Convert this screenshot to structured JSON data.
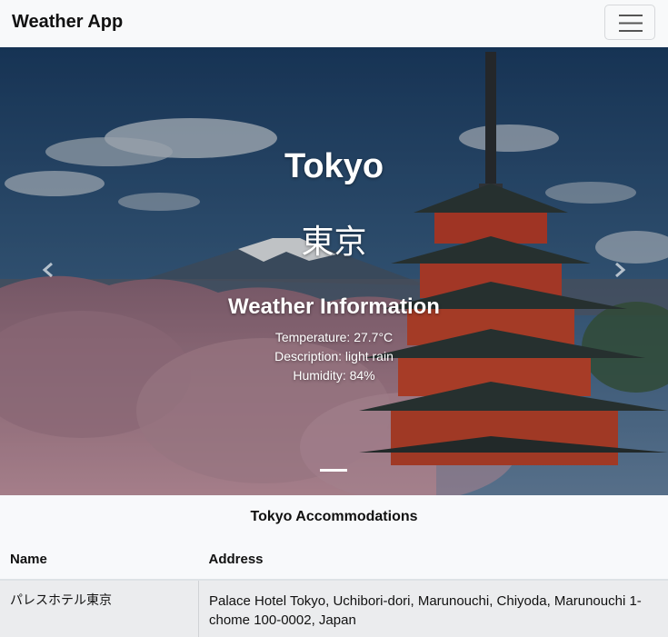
{
  "navbar": {
    "brand": "Weather App",
    "toggler_icon": "hamburger-menu-icon"
  },
  "carousel": {
    "city_name": "Tokyo",
    "city_name_local": "東京",
    "weather_title": "Weather Information",
    "temperature": "Temperature: 27.7°C",
    "description": "Description: light rain",
    "humidity": "Humidity: 84%",
    "prev_icon": "chevron-left-icon",
    "next_icon": "chevron-right-icon",
    "active_slide": 1,
    "slide_count": 1
  },
  "accommodations": {
    "title": "Tokyo Accommodations",
    "columns": [
      "Name",
      "Address"
    ],
    "rows": [
      {
        "name": "パレスホテル東京",
        "address": "Palace Hotel Tokyo, Uchibori-dori, Marunouchi, Chiyoda, Marunouchi 1-chome 100-0002, Japan"
      }
    ]
  },
  "colors": {
    "navbar_bg": "#f8f9fa",
    "table_row_bg": "#ebecee",
    "caption_text": "#ffffff"
  }
}
